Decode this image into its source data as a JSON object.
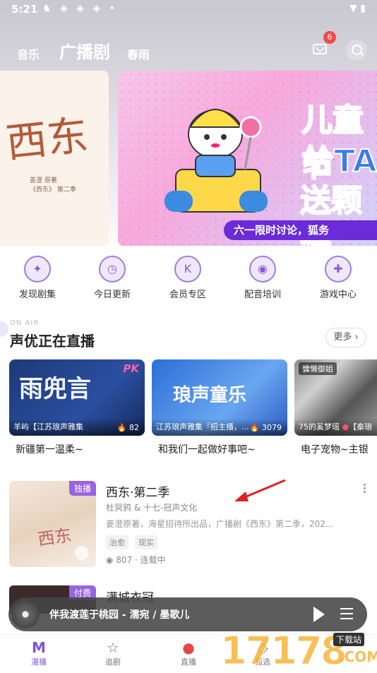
{
  "status": {
    "time": "5:21"
  },
  "topnav": {
    "tab_music": "音乐",
    "tab_drama": "广播剧",
    "tab_spring": "春雨",
    "badge_count": "6"
  },
  "banners": {
    "left_big": "西东",
    "left_small": "姜澄 原著\n《西东》 第二季",
    "main_line1": "儿童节",
    "main_line2": "给TA",
    "main_line3": "送颗糖",
    "main_strip": "六一限时讨论，狐务"
  },
  "quick_menu": [
    {
      "label": "发现剧集",
      "icon": "discover-icon"
    },
    {
      "label": "今日更新",
      "icon": "calendar-icon"
    },
    {
      "label": "会员专区",
      "icon": "vip-icon"
    },
    {
      "label": "配音培训",
      "icon": "mic-icon"
    },
    {
      "label": "游戏中心",
      "icon": "gamepad-icon"
    }
  ],
  "live": {
    "onair": "ON AIR",
    "title": "声优正在直播",
    "more": "更多",
    "cards": [
      {
        "art": "雨兜言",
        "pk": "PK",
        "name": "羊屿【江苏琅声雅集",
        "count": "82",
        "caption": "新疆第一温柔~"
      },
      {
        "art": "琅声童乐",
        "name": "江苏琅声雅集『招主播，...",
        "count": "3079",
        "caption": "和我们一起做好事吧~"
      },
      {
        "tag": "慵懒御姐",
        "name": "75的奚梦瑶",
        "name2": "【秦琅",
        "caption": "电子宠物~主银"
      }
    ]
  },
  "drama": {
    "exclusive": "独播",
    "title": "西东·第二季",
    "author": "杜冥鸦 & 十七-冠声文化",
    "desc": "姜澄原著，海星招待所出品，广播剧《西东》第二季，202...",
    "tags": [
      "治愈",
      "现实"
    ],
    "plays": "807",
    "status": "连载中"
  },
  "drama2": {
    "paid": "付费",
    "title": "满城衣冠"
  },
  "player": {
    "title": "伴我渡莲于桃园 - 濡宛 / 墨歌儿"
  },
  "bottomnav": [
    {
      "label": "漫播",
      "icon": "M"
    },
    {
      "label": "追剧",
      "icon": "☆"
    },
    {
      "label": "直播",
      "icon": "●"
    },
    {
      "label": "狐选",
      "icon": "◇"
    }
  ],
  "watermark": {
    "main": "17178",
    "sub": "下载站",
    "com": ".COM"
  }
}
